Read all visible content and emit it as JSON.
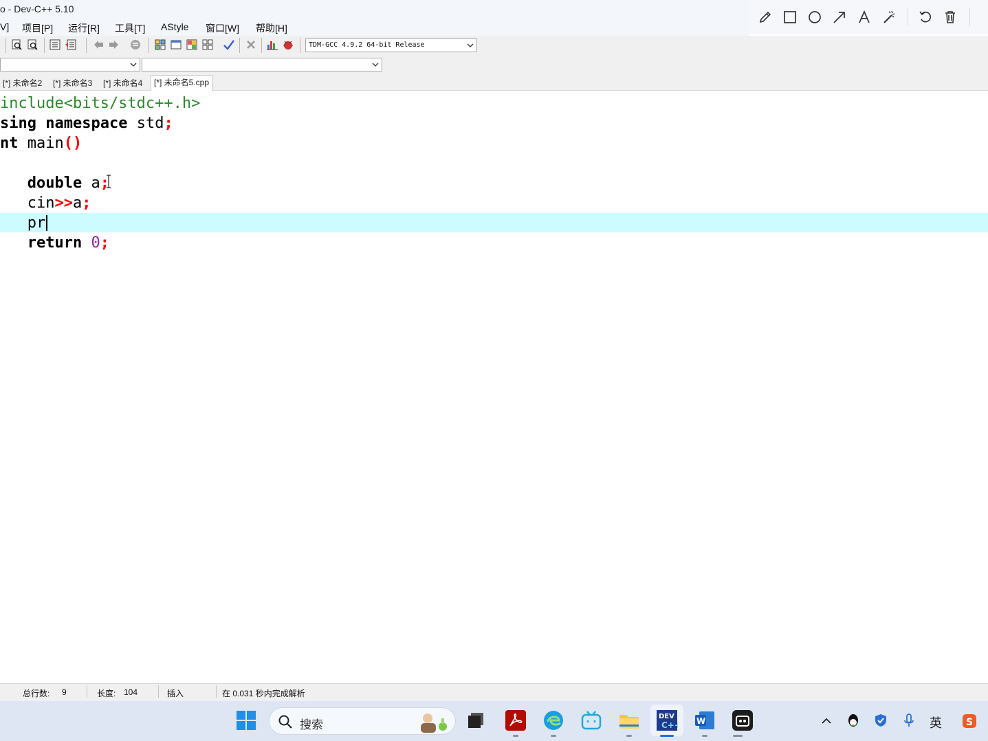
{
  "window": {
    "title": "o - Dev-C++ 5.10"
  },
  "menu": [
    "V]",
    "项目[P]",
    "运行[R]",
    "工具[T]",
    "AStyle",
    "窗口[W]",
    "帮助[H]"
  ],
  "toolbar": {
    "compiler": "TDM-GCC 4.9.2 64-bit Release"
  },
  "tabs": [
    "[*] 未命名2",
    "[*] 未命名3",
    "[*] 未命名4",
    "[*] 未命名5.cpp"
  ],
  "editor": {
    "lines": [
      {
        "parts": [
          {
            "t": "include<bits/stdc++.h>",
            "c": "inc"
          }
        ]
      },
      {
        "parts": [
          {
            "t": "sing ",
            "c": "kw"
          },
          {
            "t": "namespace",
            "c": "kw"
          },
          {
            "t": " std",
            "c": ""
          },
          {
            "t": ";",
            "c": "sym"
          }
        ]
      },
      {
        "parts": [
          {
            "t": "nt",
            "c": "kw"
          },
          {
            "t": " main",
            "c": ""
          },
          {
            "t": "()",
            "c": "sym"
          }
        ]
      },
      {
        "parts": []
      },
      {
        "parts": [
          {
            "t": "   ",
            "c": ""
          },
          {
            "t": "double",
            "c": "kw"
          },
          {
            "t": " a",
            "c": ""
          },
          {
            "t": ";",
            "c": "sym"
          }
        ]
      },
      {
        "parts": [
          {
            "t": "   cin",
            "c": ""
          },
          {
            "t": ">>",
            "c": "sym"
          },
          {
            "t": "a",
            "c": ""
          },
          {
            "t": ";",
            "c": "sym"
          }
        ]
      },
      {
        "parts": [
          {
            "t": "   pr",
            "c": ""
          }
        ]
      },
      {
        "parts": [
          {
            "t": "   ",
            "c": ""
          },
          {
            "t": "return",
            "c": "kw"
          },
          {
            "t": " ",
            "c": ""
          },
          {
            "t": "0",
            "c": "num"
          },
          {
            "t": ";",
            "c": "sym"
          }
        ]
      }
    ]
  },
  "status": {
    "total_lines_label": "总行数:",
    "total_lines": "9",
    "length_label": "长度:",
    "length": "104",
    "mode": "插入",
    "parse": "在 0.031 秒内完成解析"
  },
  "taskbar": {
    "search_placeholder": "搜索",
    "ime": "英"
  },
  "colors": {
    "current_line": "#ccfcff",
    "include": "#2a8a2a",
    "symbol": "#ff0000",
    "number": "#9b1fa0"
  }
}
